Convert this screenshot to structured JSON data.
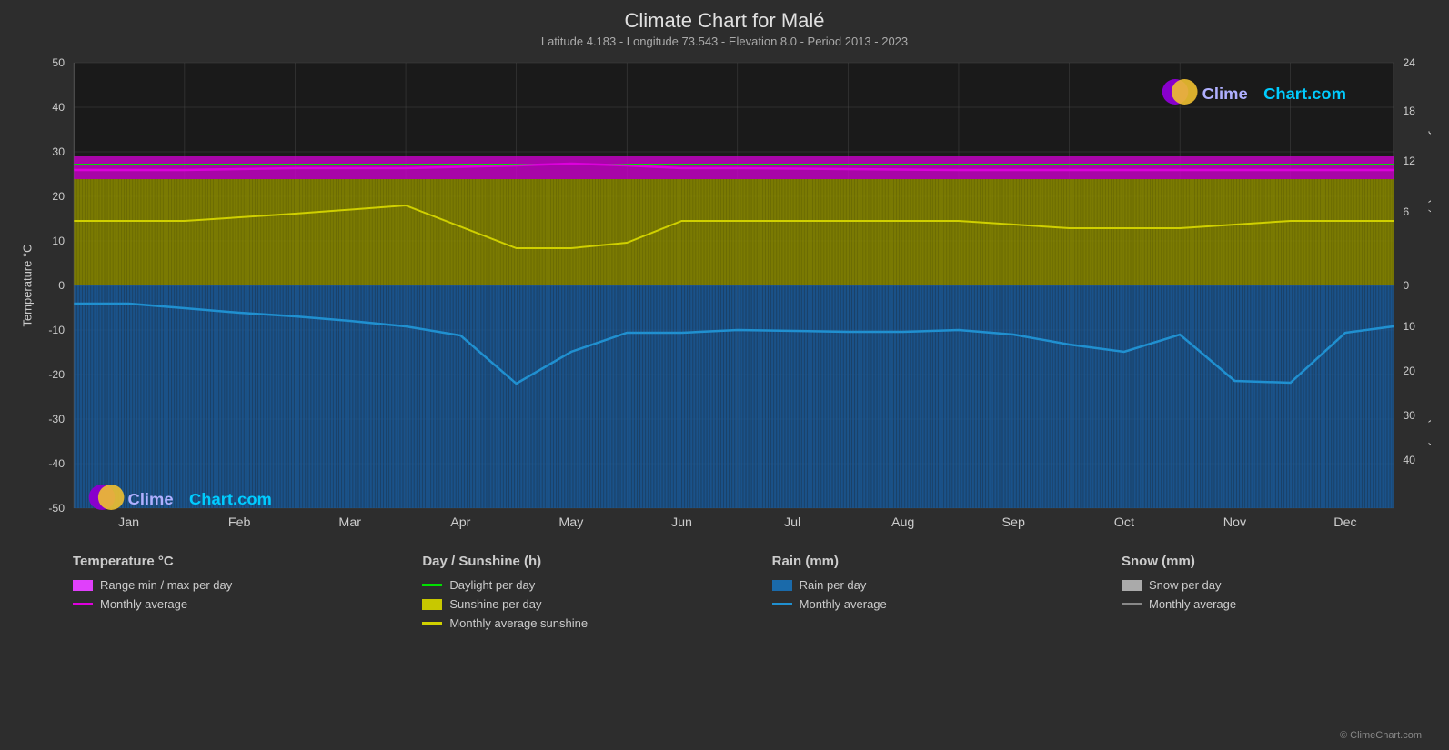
{
  "title": "Climate Chart for Malé",
  "subtitle": "Latitude 4.183 - Longitude 73.543 - Elevation 8.0 - Period 2013 - 2023",
  "copyright": "© ClimeChart.com",
  "logo": {
    "text_clime": "Clime",
    "text_chart": "Chart.com"
  },
  "y_axis_left": "Temperature °C",
  "y_axis_right_top": "Day / Sunshine (h)",
  "y_axis_right_bottom": "Rain / Snow (mm)",
  "x_axis_labels": [
    "Jan",
    "Feb",
    "Mar",
    "Apr",
    "May",
    "Jun",
    "Jul",
    "Aug",
    "Sep",
    "Oct",
    "Nov",
    "Dec"
  ],
  "y_left_ticks": [
    "50",
    "40",
    "30",
    "20",
    "10",
    "0",
    "-10",
    "-20",
    "-30",
    "-40",
    "-50"
  ],
  "y_right_top_ticks": [
    "24",
    "18",
    "12",
    "6",
    "0"
  ],
  "y_right_bottom_ticks": [
    "0",
    "10",
    "20",
    "30",
    "40"
  ],
  "legend": {
    "temperature": {
      "title": "Temperature °C",
      "items": [
        {
          "type": "swatch",
          "color": "#e040fb",
          "label": "Range min / max per day"
        },
        {
          "type": "line",
          "color": "#d040d0",
          "label": "Monthly average"
        }
      ]
    },
    "sunshine": {
      "title": "Day / Sunshine (h)",
      "items": [
        {
          "type": "line",
          "color": "#00e000",
          "label": "Daylight per day"
        },
        {
          "type": "swatch",
          "color": "#c8c800",
          "label": "Sunshine per day"
        },
        {
          "type": "line",
          "color": "#d0d000",
          "label": "Monthly average sunshine"
        }
      ]
    },
    "rain": {
      "title": "Rain (mm)",
      "items": [
        {
          "type": "swatch",
          "color": "#1a6aaa",
          "label": "Rain per day"
        },
        {
          "type": "line",
          "color": "#2090d0",
          "label": "Monthly average"
        }
      ]
    },
    "snow": {
      "title": "Snow (mm)",
      "items": [
        {
          "type": "swatch",
          "color": "#aaaaaa",
          "label": "Snow per day"
        },
        {
          "type": "line",
          "color": "#888888",
          "label": "Monthly average"
        }
      ]
    }
  }
}
